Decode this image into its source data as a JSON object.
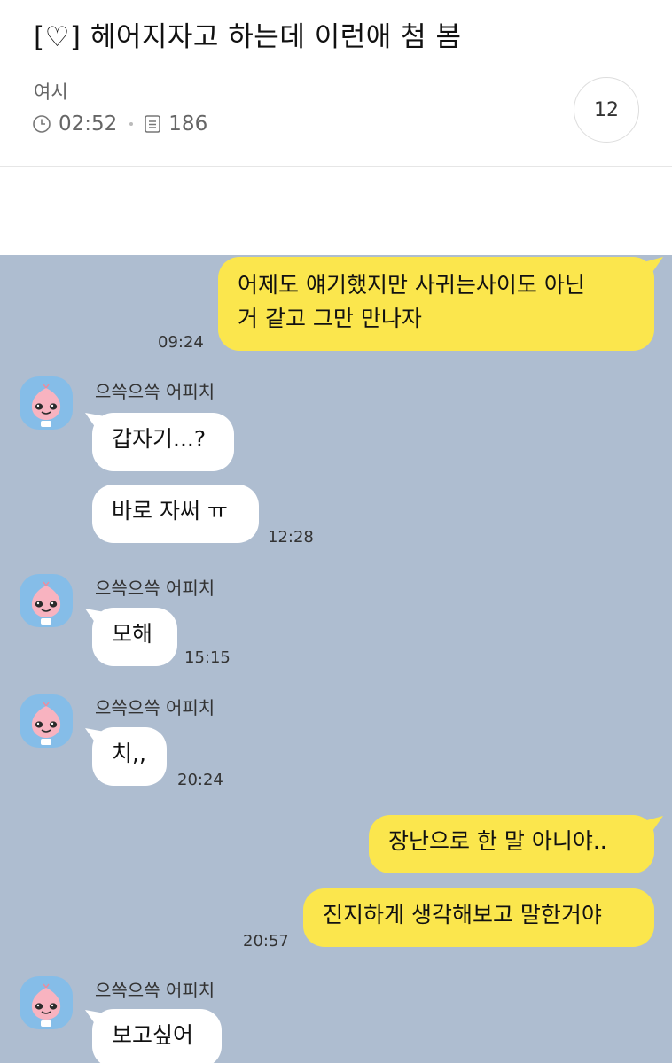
{
  "post": {
    "title": "[♡] 헤어지자고 하는데 이런애 첨 봄",
    "author": "여시",
    "time": "02:52",
    "views": "186",
    "comments": "12"
  },
  "chat": {
    "sender_name": "으쓱으쓱 어피치",
    "msg1_text": "어제도 얘기했지만 사귀는사이도 아닌 거 같고 그만 만나자",
    "msg1_line1": "어제도 얘기했지만 사귀는사이도 아닌",
    "msg1_line2": "거 같고 그만 만나자",
    "msg1_time": "09:24",
    "msg2_text": "갑자기...?",
    "msg3_text": "바로 자써 ㅠ",
    "msg3_time": "12:28",
    "msg4_text": "모해",
    "msg4_time": "15:15",
    "msg5_text": "치,,",
    "msg5_time": "20:24",
    "msg6_text": "장난으로 한 말 아니야..",
    "msg7_text": "진지하게 생각해보고 말한거야",
    "msg7_time": "20:57",
    "msg8_text": "보고싶어"
  },
  "colors": {
    "chat_background": "#aebdd0",
    "my_bubble": "#fbe64d",
    "their_bubble": "#ffffff",
    "avatar_background": "#85bde8"
  },
  "icons": {
    "time": "clock-icon",
    "views": "document-list-icon"
  }
}
